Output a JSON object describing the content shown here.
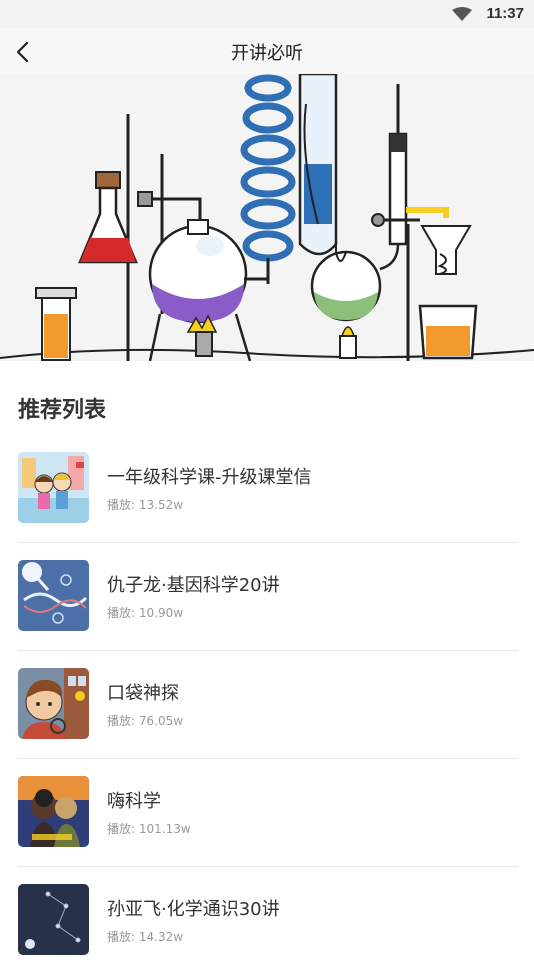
{
  "status": {
    "time": "11:37",
    "wifi_icon": "wifi-icon"
  },
  "nav": {
    "title": "开讲必听",
    "back_icon": "chevron-left-icon"
  },
  "hero": {
    "image": "chemistry-lab-illustration"
  },
  "section": {
    "title": "推荐列表"
  },
  "items": [
    {
      "title": "一年级科学课-升级课堂信",
      "plays": "播放: 13.52w",
      "thumb": "kids-cartoon-thumb"
    },
    {
      "title": "仇子龙·基因科学20讲",
      "plays": "播放: 10.90w",
      "thumb": "dna-thumb"
    },
    {
      "title": "口袋神探",
      "plays": "播放: 76.05w",
      "thumb": "detective-boy-thumb"
    },
    {
      "title": "嗨科学",
      "plays": "播放: 101.13w",
      "thumb": "science-kids-thumb"
    },
    {
      "title": "孙亚飞·化学通识30讲",
      "plays": "播放: 14.32w",
      "thumb": "constellation-thumb"
    }
  ],
  "colors": {
    "accent_blue": "#2f6fb5",
    "liquid_red": "#d62a2a",
    "liquid_purple": "#8a5cc7",
    "liquid_green": "#8cc07a",
    "liquid_orange": "#f29a2e"
  }
}
